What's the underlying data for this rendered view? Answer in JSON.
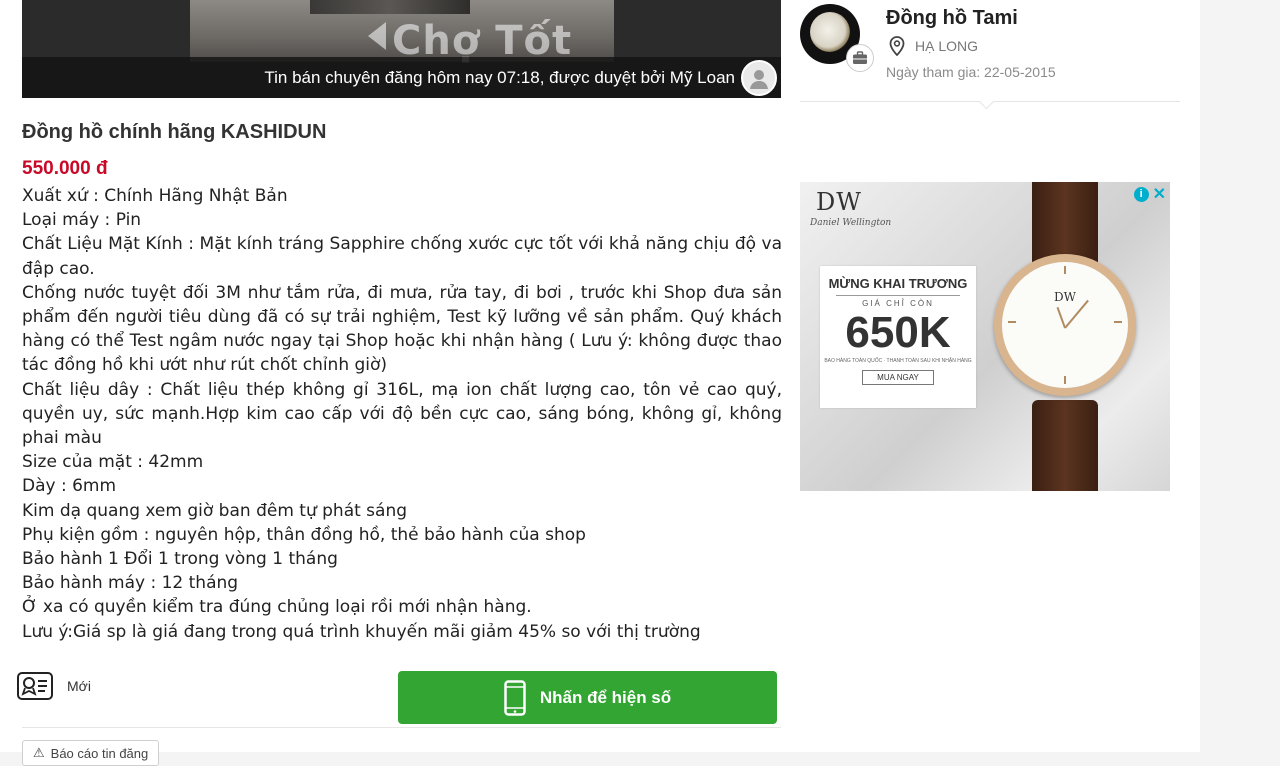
{
  "hero": {
    "watermark": "Chợ Tốt",
    "caption": "Tin bán chuyên đăng hôm nay 07:18, được duyệt bởi Mỹ Loan"
  },
  "listing": {
    "title": "Đồng hồ chính hãng KASHIDUN",
    "price": "550.000 đ",
    "description": [
      "Xuất xứ : Chính Hãng Nhật Bản",
      "Loại máy : Pin",
      "Chất Liệu Mặt Kính : Mặt kính tráng Sapphire chống xước cực tốt với khả năng chịu độ va đập cao.",
      "Chống nước tuyệt đối 3M như tắm rửa, đi mưa, rửa tay, đi bơi , trước khi Shop đưa sản phẩm đến người tiêu dùng đã có sự trải nghiệm, Test kỹ lưỡng về sản phẩm. Quý khách hàng có thể Test ngâm nước ngay tại Shop hoặc khi nhận hàng ( Lưu ý: không được thao tác đồng hồ khi ướt như rút chốt chỉnh giờ)",
      "Chất liệu dây : Chất liệu thép không gỉ 316L, mạ ion chất lượng cao, tôn vẻ cao quý, quyền uy, sức mạnh.Hợp kim cao cấp với độ bền cực cao, sáng bóng, không gỉ, không phai màu",
      "Size của mặt : 42mm",
      "Dày : 6mm",
      "Kim dạ quang xem giờ ban đêm tự phát sáng",
      "Phụ kiện gồm : nguyên hộp, thân đồng hồ, thẻ bảo hành của shop",
      "Bảo hành 1 Đổi 1 trong vòng 1 tháng",
      "Bảo hành máy : 12 tháng",
      "Ở xa có quyền kiểm tra đúng chủng loại rồi mới nhận hàng.",
      "Lưu ý:Giá sp là giá đang trong quá trình khuyến mãi giảm 45% so với thị trường"
    ],
    "condition": "Mới",
    "show_phone_label": "Nhấn để hiện số",
    "report_label": "Báo cáo tin đăng"
  },
  "seller": {
    "name": "Đồng hồ Tami",
    "location": "HẠ LONG",
    "joined": "Ngày tham gia: 22-05-2015"
  },
  "ad": {
    "brand": "DW",
    "brand_full": "Daniel Wellington",
    "headline": "MỪNG KHAI TRƯƠNG",
    "sub": "GIÁ CHỈ CÒN",
    "price": "650K",
    "fine_print": "BAO HÀNG TOÀN QUỐC · THANH TOÁN SAU KHI NHẬN HÀNG",
    "cta": "MUA NGAY",
    "info_symbol": "i",
    "close_symbol": "✕"
  },
  "colors": {
    "price": "#c90927",
    "cta_green": "#33a532",
    "ad_accent": "#00aecd"
  }
}
